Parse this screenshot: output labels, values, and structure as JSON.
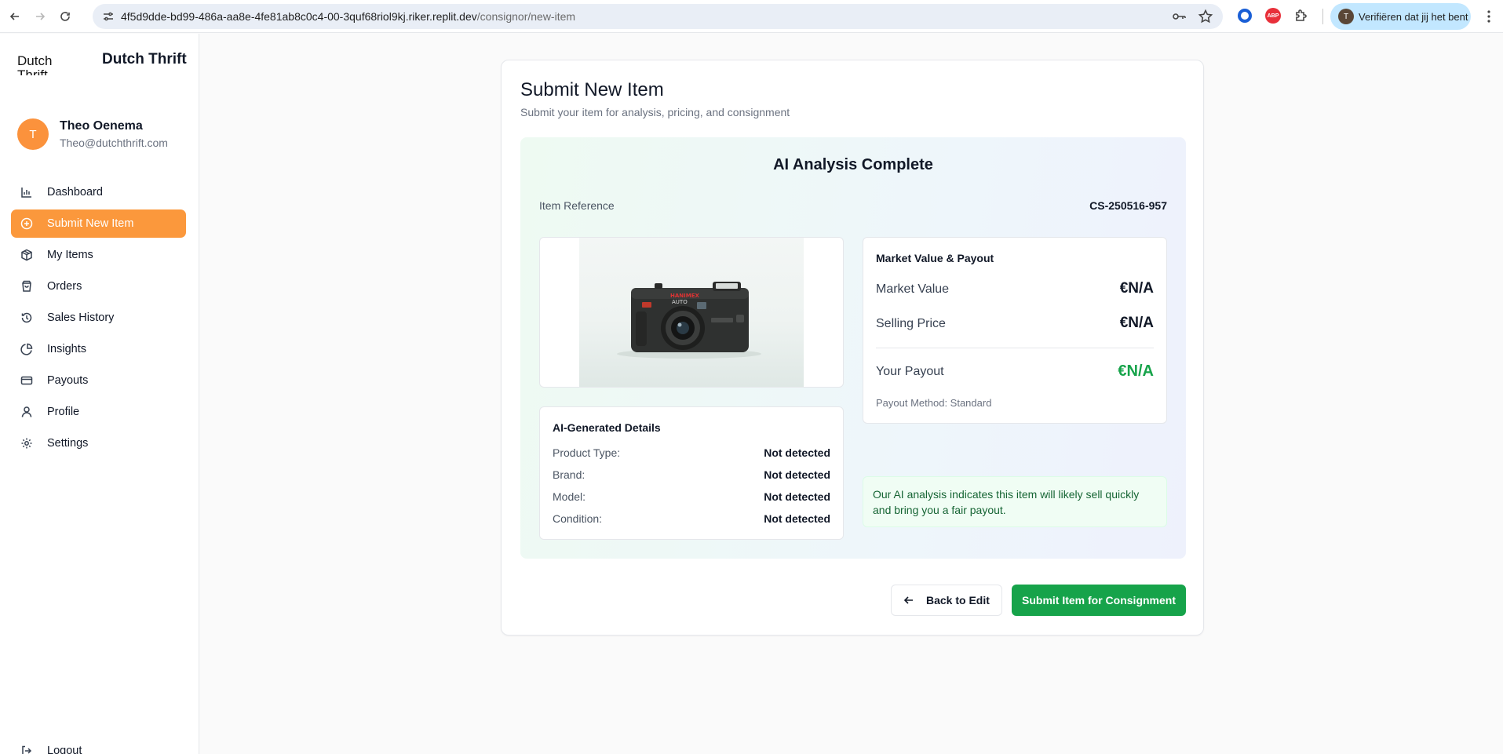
{
  "browser": {
    "url_host": "4f5d9dde-bd99-486a-aa8e-4fe81ab8c0c4-00-3quf68riol9kj.riker.replit.dev",
    "url_path": "/consignor/new-item",
    "profile_label": "Verifiëren dat jij het bent",
    "profile_initial": "T",
    "abp_label": "ABP"
  },
  "sidebar": {
    "logo_alt": "Dutch Thrift",
    "brand": "Dutch Thrift",
    "user": {
      "initial": "T",
      "name": "Theo Oenema",
      "email": "Theo@dutchthrift.com"
    },
    "items": [
      {
        "label": "Dashboard",
        "icon": "bar-chart-icon"
      },
      {
        "label": "Submit New Item",
        "icon": "plus-circle-icon",
        "active": true
      },
      {
        "label": "My Items",
        "icon": "package-icon"
      },
      {
        "label": "Orders",
        "icon": "shopping-bag-icon"
      },
      {
        "label": "Sales History",
        "icon": "history-icon"
      },
      {
        "label": "Insights",
        "icon": "pie-chart-icon"
      },
      {
        "label": "Payouts",
        "icon": "credit-card-icon"
      },
      {
        "label": "Profile",
        "icon": "user-icon"
      },
      {
        "label": "Settings",
        "icon": "gear-icon"
      }
    ],
    "logout_label": "Logout"
  },
  "main": {
    "title": "Submit New Item",
    "subtitle": "Submit your item for analysis, pricing, and consignment",
    "analysis": {
      "title": "AI Analysis Complete",
      "reference_label": "Item Reference",
      "reference_value": "CS-250516-957",
      "details": {
        "title": "AI-Generated Details",
        "rows": [
          {
            "label": "Product Type:",
            "value": "Not detected"
          },
          {
            "label": "Brand:",
            "value": "Not detected"
          },
          {
            "label": "Model:",
            "value": "Not detected"
          },
          {
            "label": "Condition:",
            "value": "Not detected"
          }
        ]
      },
      "market": {
        "title": "Market Value & Payout",
        "market_value_label": "Market Value",
        "market_value": "€N/A",
        "selling_price_label": "Selling Price",
        "selling_price": "€N/A",
        "payout_label": "Your Payout",
        "payout": "€N/A",
        "payout_method": "Payout Method: Standard"
      },
      "note": "Our AI analysis indicates this item will likely sell quickly and bring you a fair payout."
    },
    "actions": {
      "back_label": "Back to Edit",
      "submit_label": "Submit Item for Consignment"
    }
  },
  "colors": {
    "accent": "#fb983c",
    "success": "#16a34a"
  }
}
